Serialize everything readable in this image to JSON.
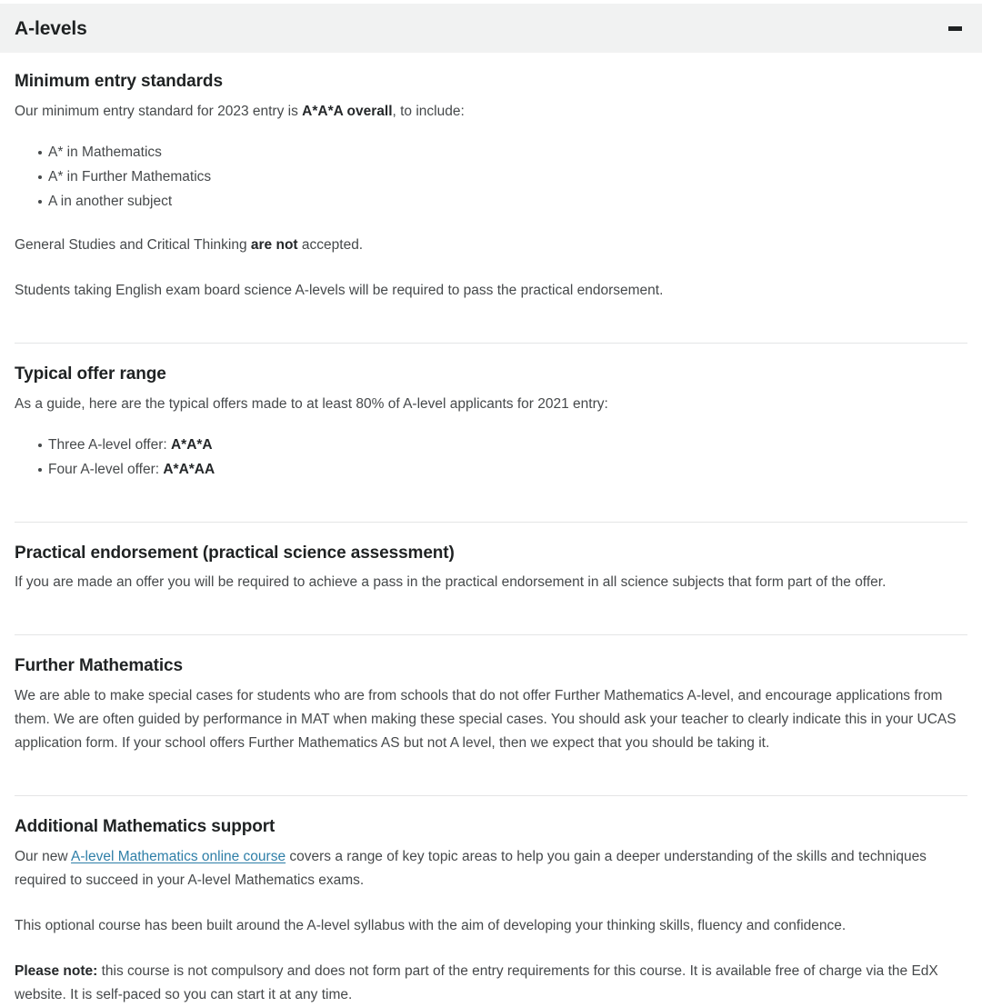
{
  "header": {
    "title": "A-levels",
    "toggle_icon": "minus-icon",
    "toggle_state": "expanded"
  },
  "colors": {
    "header_background": "#f1f2f2",
    "heading_text": "#1f2223",
    "body_text": "#46494b",
    "link": "#2f7fa8",
    "divider": "#e4e5e6",
    "page_background": "#ffffff"
  },
  "sections": {
    "minimum_entry": {
      "heading": "Minimum entry standards",
      "intro_before": "Our minimum entry standard for 2023 entry is ",
      "intro_bold": "A*A*A overall",
      "intro_after": ", to include:",
      "bullets": [
        "A* in Mathematics",
        "A* in Further Mathematics",
        "A in another subject"
      ],
      "note_before": "General Studies and Critical Thinking ",
      "note_bold": "are not",
      "note_after": " accepted.",
      "endorsement_note": "Students taking English exam board science A-levels will be required to pass the practical endorsement."
    },
    "typical_offer": {
      "heading": "Typical offer range",
      "intro": "As a guide, here are the typical offers made to at least 80% of A-level applicants for 2021 entry:",
      "offers": [
        {
          "label": "Three A-level offer: ",
          "grades": "A*A*A"
        },
        {
          "label": "Four A-level offer: ",
          "grades": "A*A*AA"
        }
      ]
    },
    "practical_endorsement": {
      "heading": "Practical endorsement (practical science assessment)",
      "body": "If you are made an offer you will be required to achieve a pass in the practical endorsement in all science subjects that form part of the offer."
    },
    "further_maths": {
      "heading": "Further Mathematics",
      "body": "We are able to make special cases for students who are from schools that do not offer Further Mathematics A-level, and encourage applications from them. We are often guided by performance in MAT when making these special cases. You should ask your teacher to clearly indicate this in your UCAS application form. If your school offers Further Mathematics AS but not A level, then we expect that you should be taking it."
    },
    "additional_support": {
      "heading": "Additional Mathematics support",
      "p1_before": "Our new ",
      "p1_link": "A-level Mathematics online course",
      "p1_after": " covers a range of key topic areas to help you gain a deeper understanding of the skills and techniques required to succeed in your A-level Mathematics exams.",
      "p2": "This optional course has been built around the A-level syllabus with the aim of developing your thinking skills, fluency and confidence.",
      "p3_bold": "Please note:",
      "p3_after": " this course is not compulsory and does not form part of the entry requirements for this course. It is available free of charge via the EdX website. It is self-paced so you can start it at any time."
    }
  }
}
